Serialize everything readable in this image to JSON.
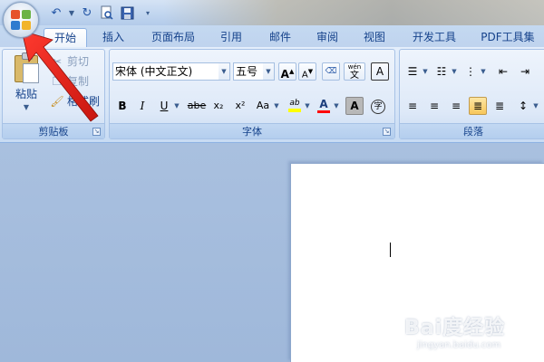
{
  "quick_access": {
    "icons": [
      "undo-icon",
      "dropdown-arrow-icon",
      "redo-icon",
      "print-preview-icon",
      "save-icon",
      "customize-icon"
    ]
  },
  "tabs": [
    {
      "label": "开始",
      "active": true
    },
    {
      "label": "插入"
    },
    {
      "label": "页面布局"
    },
    {
      "label": "引用"
    },
    {
      "label": "邮件"
    },
    {
      "label": "审阅"
    },
    {
      "label": "视图"
    },
    {
      "label": "开发工具"
    },
    {
      "label": "PDF工具集"
    }
  ],
  "clipboard": {
    "paste_label": "粘贴",
    "cut_label": "剪切",
    "copy_label": "复制",
    "format_painter_label": "格式刷",
    "group_label": "剪贴板"
  },
  "font": {
    "font_name": "宋体 (中文正文)",
    "font_size": "五号",
    "grow_font": "A",
    "shrink_font": "A",
    "phonetic_guide": "wén",
    "phonetic_char": "文",
    "char_border": "A",
    "bold": "B",
    "italic": "I",
    "underline": "U",
    "strikethrough": "abe",
    "subscript": "x₂",
    "superscript": "x²",
    "change_case": "Aa",
    "highlight": "ab",
    "font_color": "A",
    "char_shading": "A",
    "enclose_char": "字",
    "group_label": "字体"
  },
  "paragraph": {
    "group_label": "段落"
  },
  "colors": {
    "accent": "#15428b",
    "red_annotation": "#e0201b",
    "highlight_yellow": "#ffff00",
    "font_red": "#ff0000"
  },
  "watermark": {
    "title": "Bai度经验",
    "url": "jingyan.baidu.com"
  }
}
